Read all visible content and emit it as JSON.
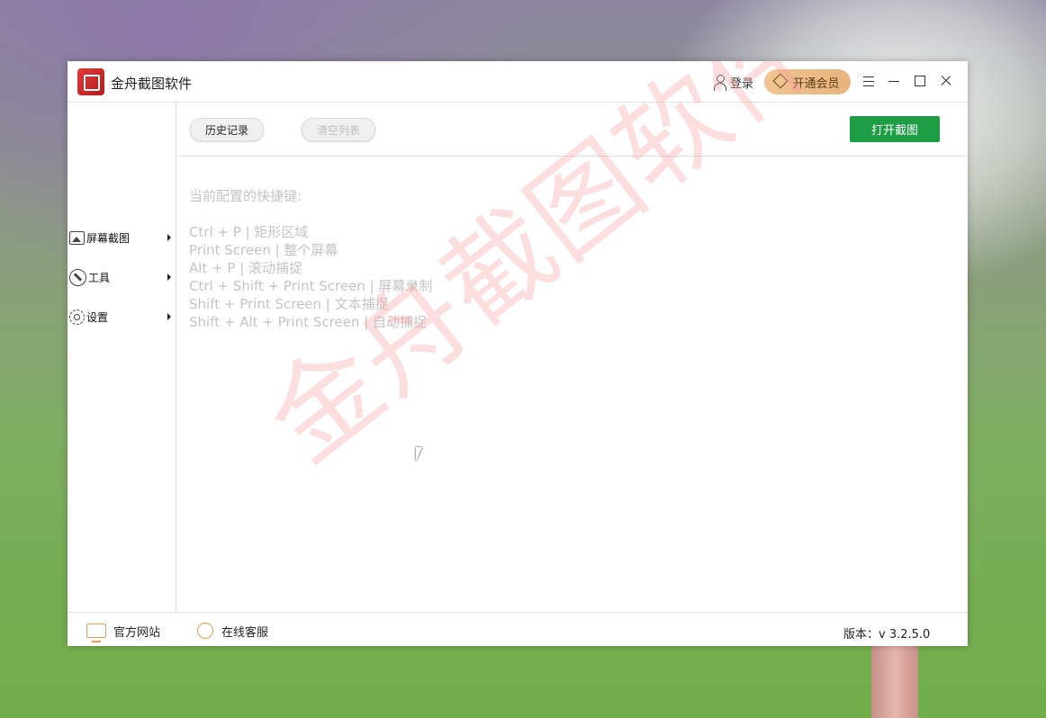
{
  "app": {
    "title": "金舟截图软件",
    "login_label": "登录",
    "vip_label": "开通会员"
  },
  "sidebar": {
    "items": [
      {
        "label": "屏幕截图",
        "icon": "image-icon"
      },
      {
        "label": "工具",
        "icon": "wrench-icon"
      },
      {
        "label": "设置",
        "icon": "gear-icon"
      }
    ]
  },
  "toolbar": {
    "history_label": "历史记录",
    "clear_label": "清空列表",
    "open_label": "打开截图",
    "accent_color": "#1d9e45"
  },
  "content": {
    "heading": "当前配置的快捷键:",
    "shortcuts": [
      "Ctrl + P  |  矩形区域",
      "Print Screen  |  整个屏幕",
      "Alt + P  |  滚动捕捉",
      "Ctrl + Shift + Print Screen  |  屏幕录制",
      "Shift + Print Screen  |  文本捕捉",
      "Shift + Alt + Print Screen  |  自动捕捉"
    ],
    "watermark": "金舟截图软件"
  },
  "footer": {
    "website_label": "官方网站",
    "support_label": "在线客服",
    "version_label": "版本：v 3.2.5.0"
  }
}
